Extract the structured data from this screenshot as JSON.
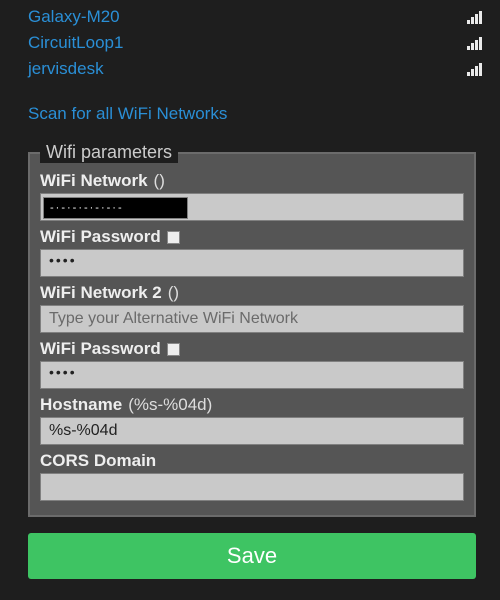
{
  "networks": [
    {
      "name": "Galaxy-M20"
    },
    {
      "name": "CircuitLoop1"
    },
    {
      "name": "jervisdesk"
    }
  ],
  "scan_label": "Scan for all WiFi Networks",
  "fieldset_legend": "Wifi parameters",
  "fields": {
    "ssid1": {
      "label": "WiFi Network",
      "hint": "()",
      "value": "-·-·-·-·-·-·-"
    },
    "pass1": {
      "label": "WiFi Password",
      "value": "••••"
    },
    "ssid2": {
      "label": "WiFi Network 2",
      "hint": "()",
      "placeholder": "Type your Alternative WiFi Network",
      "value": ""
    },
    "pass2": {
      "label": "WiFi Password",
      "value": "••••"
    },
    "hostname": {
      "label": "Hostname",
      "hint": "(%s-%04d)",
      "value": "%s-%04d"
    },
    "cors": {
      "label": "CORS Domain",
      "value": ""
    }
  },
  "save_label": "Save"
}
